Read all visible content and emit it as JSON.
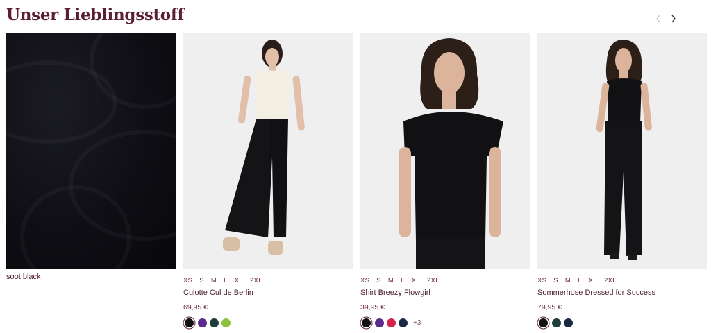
{
  "section": {
    "title": "Unser Lieblingsstoff"
  },
  "nav": {
    "prev_icon": "chevron-left-icon",
    "next_icon": "chevron-right-icon"
  },
  "fabric": {
    "label": "soot black",
    "color": "#0e0e14"
  },
  "products": [
    {
      "sizes": [
        "XS",
        "S",
        "M",
        "L",
        "XL",
        "2XL"
      ],
      "name": "Culotte Cul de Berlin",
      "price": "69,95 €",
      "swatches": [
        "#111111",
        "#5b2a8c",
        "#1f3d3a",
        "#8fbf3f"
      ],
      "more": ""
    },
    {
      "sizes": [
        "XS",
        "S",
        "M",
        "L",
        "XL",
        "2XL"
      ],
      "name": "Shirt Breezy Flowgirl",
      "price": "39,95 €",
      "swatches": [
        "#111111",
        "#5b2a8c",
        "#d4244a",
        "#1a2a44"
      ],
      "more": "+3"
    },
    {
      "sizes": [
        "XS",
        "S",
        "M",
        "L",
        "XL",
        "2XL"
      ],
      "name": "Sommerhose Dressed for Success",
      "price": "79,95 €",
      "swatches": [
        "#111111",
        "#1f3d3a",
        "#1a2a44"
      ],
      "more": ""
    }
  ],
  "colors": {
    "accent": "#5a1f33"
  }
}
